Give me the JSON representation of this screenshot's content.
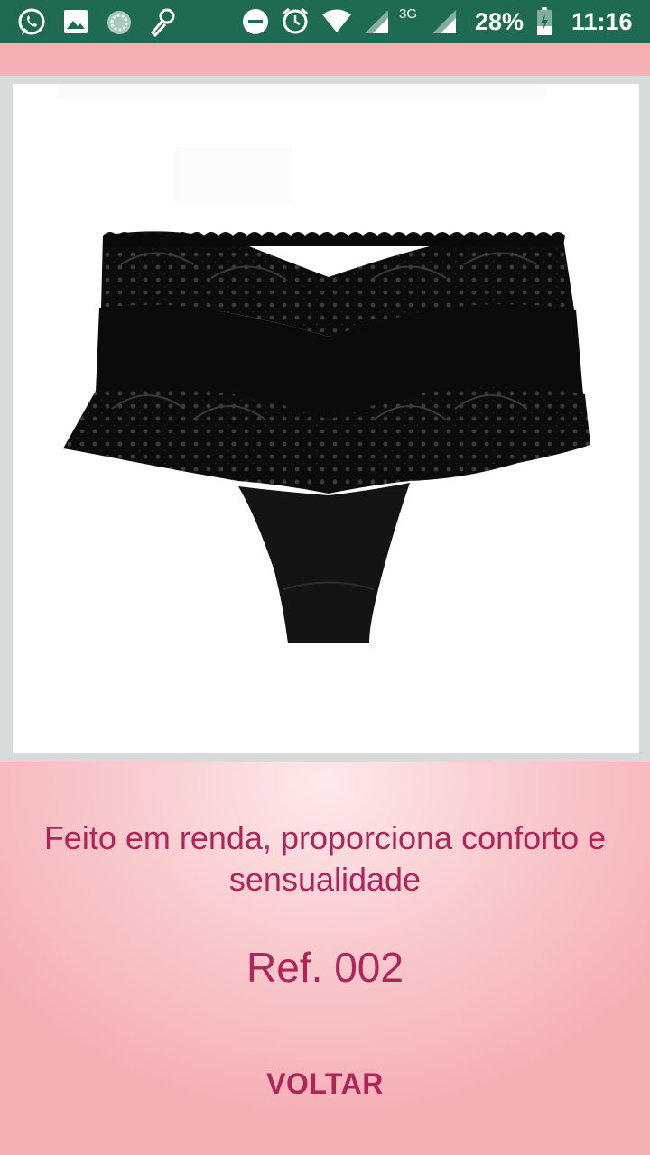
{
  "status_bar": {
    "network_label": "3G",
    "battery": "28%",
    "time": "11:16",
    "icons": [
      "whatsapp-icon",
      "gallery-icon",
      "sync-icon",
      "microphone-icon",
      "do-not-disturb-icon",
      "alarm-icon",
      "wifi-icon",
      "cell-signal-icon",
      "cell-signal-3g-icon",
      "battery-charging-icon"
    ]
  },
  "product": {
    "image": "black-lace-panty",
    "description": "Feito em renda, proporciona conforto e sensualidade",
    "reference": "Ref. 002",
    "back_label": "VOLTAR"
  },
  "colors": {
    "status_bar": "#1e6b52",
    "accent_pink": "#f5b0b6",
    "text_magenta": "#b0245a"
  }
}
